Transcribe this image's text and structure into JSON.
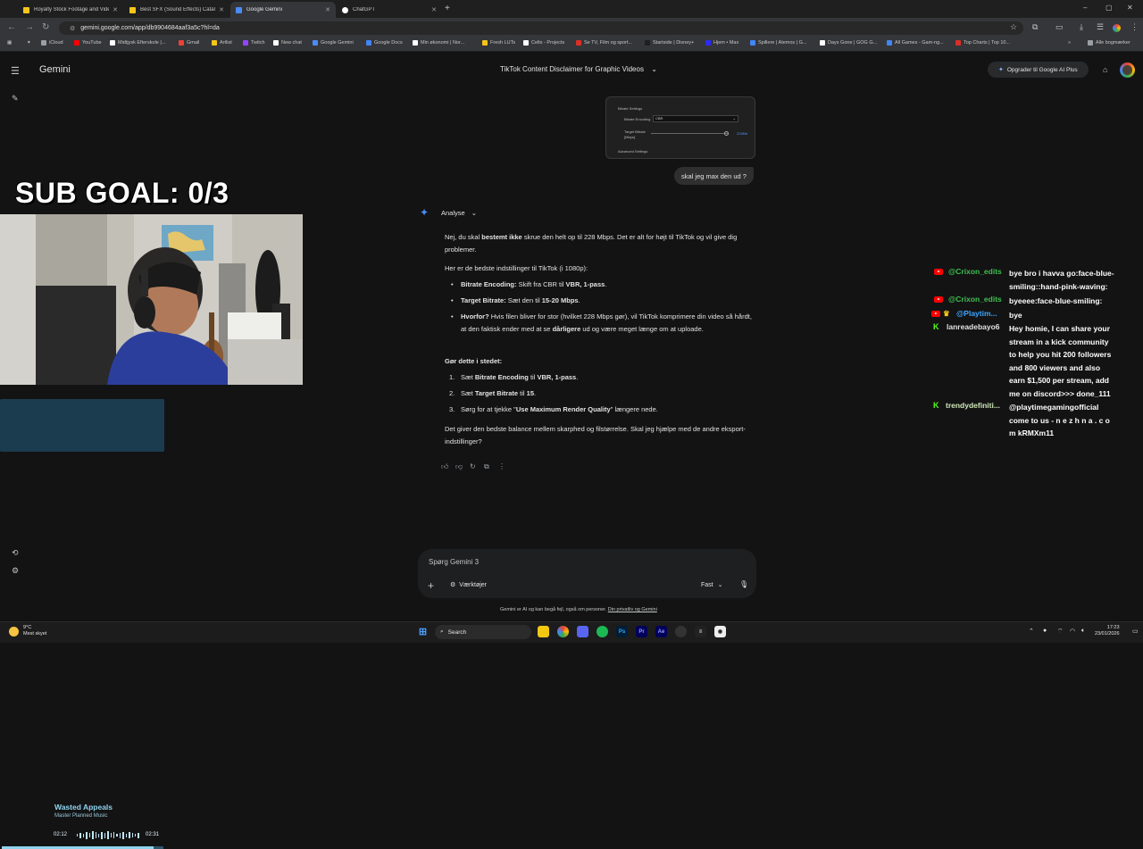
{
  "browser": {
    "tabs": [
      {
        "title": "Royalty Stock Footage and Vide",
        "active": false,
        "color": "#f5c518"
      },
      {
        "title": "Best SFX (Sound Effects) Catalo",
        "active": false,
        "color": "#f5c518"
      },
      {
        "title": "Google Gemini",
        "active": true,
        "color": "#4a8cf7"
      },
      {
        "title": "ChatGPT",
        "active": false,
        "color": "#ffffff"
      }
    ],
    "url": "gemini.google.com/app/db9904684aaf3a5c?hl=da",
    "bookmarks": [
      {
        "label": "iCloud",
        "color": "#9aa0a6"
      },
      {
        "label": "YouTube",
        "color": "#ff0000"
      },
      {
        "label": "Midtjysk Efterskole |...",
        "color": "#ffffff"
      },
      {
        "label": "Gmail",
        "color": "#ea4335"
      },
      {
        "label": "Artlist",
        "color": "#f5c518"
      },
      {
        "label": "Twitch",
        "color": "#9146ff"
      },
      {
        "label": "New chat",
        "color": "#ffffff"
      },
      {
        "label": "Google Gemini",
        "color": "#4a8cf7"
      },
      {
        "label": "Google Docs",
        "color": "#4285f4"
      },
      {
        "label": "Min økonomi | Nor...",
        "color": "#ffffff"
      },
      {
        "label": "Fresh LUTs",
        "color": "#f5c518"
      },
      {
        "label": "Celtx - Projects",
        "color": "#ffffff"
      },
      {
        "label": "Se TV, Film og sport...",
        "color": "#d93025"
      },
      {
        "label": "Startside | Disney+",
        "color": "#1f1f1f"
      },
      {
        "label": "Hjem • Max",
        "color": "#2b2bff"
      },
      {
        "label": "Spillere | Atemos | G...",
        "color": "#4285f4"
      },
      {
        "label": "Days Gone | GOG G...",
        "color": "#ffffff"
      },
      {
        "label": "All Games - Gam-ng...",
        "color": "#4285f4"
      },
      {
        "label": "Top Charts | Top 10...",
        "color": "#d93025"
      }
    ],
    "all_bookmarks": "Alle bogmærker"
  },
  "gemini": {
    "brand": "Gemini",
    "conversation_title": "TikTok Content Disclaimer for Graphic Videos",
    "upgrade_label": "Opgrader til Google AI Plus",
    "attachment": {
      "heading": "Bitrate Settings",
      "encoding_label": "Bitrate Encoding",
      "encoding_value": "CBR",
      "target_label": "Target Bitrate",
      "target_unit": "[Mbps]",
      "target_value": "228Mb",
      "advanced": "Advanced Settings"
    },
    "user_message": "skal jeg max den ud ?",
    "mode_label": "Analyse",
    "response": {
      "p1_a": "Nej, du skal ",
      "p1_b": "bestemt ikke",
      "p1_c": " skrue den helt op til 228 Mbps. Det er alt for højt til TikTok og vil give dig problemer.",
      "p2": "Her er de bedste indstillinger til TikTok (i 1080p):",
      "bullets": [
        {
          "strong": "Bitrate Encoding:",
          "text_a": " Skift fra CBR til ",
          "strong2": "VBR, 1-pass",
          "text_b": "."
        },
        {
          "strong": "Target Bitrate:",
          "text_a": " Sæt den til ",
          "strong2": "15-20 Mbps",
          "text_b": "."
        },
        {
          "strong": "Hvorfor?",
          "text_a": " Hvis filen bliver for stor (hvilket 228 Mbps gør), vil TikTok komprimere din video så hårdt, at den faktisk ender med at se ",
          "strong2": "dårligere",
          "text_b": " ud og være meget længe om at uploade."
        }
      ],
      "do_heading": "Gør dette i stedet:",
      "steps": [
        {
          "num": "1.",
          "a": "Sæt ",
          "b": "Bitrate Encoding",
          "c": " til ",
          "d": "VBR, 1-pass",
          "e": "."
        },
        {
          "num": "2.",
          "a": "Sæt ",
          "b": "Target Bitrate",
          "c": " til ",
          "d": "15",
          "e": "."
        },
        {
          "num": "3.",
          "a": "Sørg for at tjekke \"",
          "b": "Use Maximum Render Quality",
          "c": "\" længere nede.",
          "d": "",
          "e": ""
        }
      ],
      "closing": "Det giver den bedste balance mellem skarphed og filstørrelse. Skal jeg hjælpe med de andre eksport-indstillinger?"
    },
    "prompt_placeholder": "Spørg Gemini 3",
    "tools_label": "Værktøjer",
    "model_label": "Fast",
    "disclaimer_text": "Gemini er AI og kan begå fejl, også om personer. ",
    "disclaimer_link": "Din privatliv og Gemini"
  },
  "overlay": {
    "sub_goal": "SUB GOAL: 0/3",
    "music": {
      "title": "Wasted Appeals",
      "artist": "Master Planned Music",
      "elapsed": "02:12",
      "total": "02:31",
      "progress": 0.94
    },
    "chat": [
      {
        "name": "@Crixon_edits",
        "platform": "youtube",
        "name_color": "#3fbf4f",
        "lines": [
          "bye bro i havva go:face-blue-",
          "smiling::hand-pink-waving:"
        ]
      },
      {
        "name": "@Crixon_edits",
        "platform": "youtube",
        "name_color": "#3fbf4f",
        "lines": [
          "byeeee:face-blue-smiling:"
        ]
      },
      {
        "name": "@Playtim...",
        "platform": "youtube",
        "name_color": "#3ea6ff",
        "lines": [
          "bye"
        ]
      },
      {
        "name": "lanreadebayo6",
        "platform": "kick",
        "name_color": "#e3e3e3",
        "lines": [
          "Hey homie, I can share your",
          "stream in a kick community",
          "to help you hit 200 followers",
          "and 800 viewers and also",
          "earn $1,500 per stream, add",
          "me on discord>>> done_111"
        ]
      },
      {
        "name": "trendydefiniti...",
        "platform": "kick",
        "name_color": "#cfe8b8",
        "lines": [
          "@playtimegamingofficial",
          "come to us - n e z h n a . c o",
          "m kRMXm11"
        ]
      }
    ]
  },
  "taskbar": {
    "weather_temp": "9°C",
    "weather_desc": "Mest skyet",
    "search": "Search",
    "time": "17:23",
    "date": "23/01/2026"
  }
}
